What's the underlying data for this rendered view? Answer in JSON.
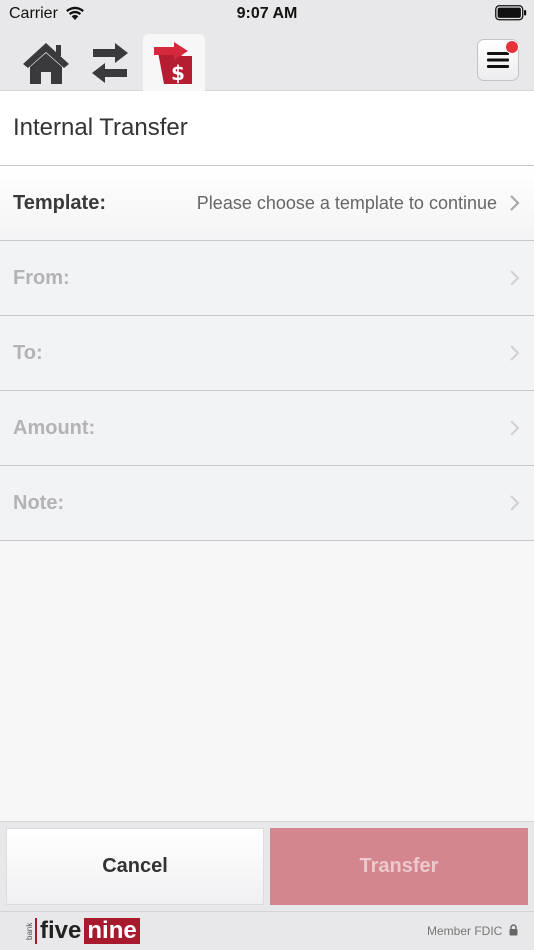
{
  "status_bar": {
    "carrier": "Carrier",
    "time": "9:07 AM"
  },
  "nav": {
    "tabs": [
      {
        "id": "home",
        "icon": "home-icon"
      },
      {
        "id": "transfers",
        "icon": "swap-arrows-icon"
      },
      {
        "id": "internal-transfer",
        "icon": "money-transfer-icon",
        "active": true
      }
    ],
    "menu_icon": "hamburger-menu-icon",
    "has_notification": true
  },
  "page": {
    "title": "Internal Transfer"
  },
  "form": {
    "rows": [
      {
        "label": "Template:",
        "value": "Please choose a template to continue",
        "enabled": true
      },
      {
        "label": "From:",
        "value": "",
        "enabled": false
      },
      {
        "label": "To:",
        "value": "",
        "enabled": false
      },
      {
        "label": "Amount:",
        "value": "",
        "enabled": false
      },
      {
        "label": "Note:",
        "value": "",
        "enabled": false
      }
    ]
  },
  "actions": {
    "cancel_label": "Cancel",
    "transfer_label": "Transfer",
    "transfer_enabled": false
  },
  "footer": {
    "logo": {
      "bank": "bank",
      "five": "five",
      "nine": "nine"
    },
    "fdic": "Member FDIC"
  },
  "colors": {
    "brand_red": "#a8192e",
    "transfer_disabled": "#d3868e",
    "notification": "#e8323a"
  }
}
